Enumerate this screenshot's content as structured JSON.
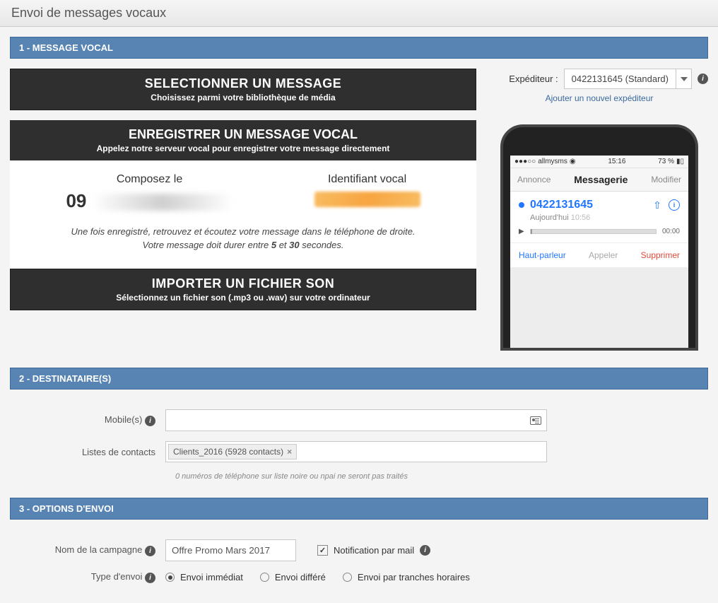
{
  "page": {
    "title": "Envoi de messages vocaux"
  },
  "section1": {
    "header": "1 - MESSAGE VOCAL",
    "select_msg": {
      "title": "SELECTIONNER UN MESSAGE",
      "sub": "Choisissez parmi votre bibliothèque de média"
    },
    "record": {
      "title": "ENREGISTRER UN MESSAGE VOCAL",
      "sub": "Appelez notre serveur vocal pour enregistrer votre message directement",
      "compose_label": "Composez le",
      "compose_prefix": "09",
      "ident_label": "Identifiant vocal",
      "note1": "Une fois enregistré, retrouvez et écoutez votre message dans le téléphone de droite.",
      "note2_a": "Votre message doit durer entre ",
      "note2_b": "5",
      "note2_c": " et ",
      "note2_d": "30",
      "note2_e": " secondes."
    },
    "import": {
      "title": "IMPORTER UN FICHIER SON",
      "sub": "Sélectionnez un fichier son (.mp3 ou .wav) sur votre ordinateur"
    },
    "sender": {
      "label": "Expéditeur :",
      "value": "0422131645 (Standard)",
      "add_link": "Ajouter un nouvel expéditeur"
    },
    "phone": {
      "carrier": "allmysms",
      "time": "15:16",
      "battery": "73 %",
      "nav_left": "Annonce",
      "nav_center": "Messagerie",
      "nav_right": "Modifier",
      "vm_number": "0422131645",
      "vm_date_a": "Aujourd'hui",
      "vm_date_b": "10:56",
      "vm_duration": "00:00",
      "action_speaker": "Haut-parleur",
      "action_call": "Appeler",
      "action_delete": "Supprimer"
    }
  },
  "section2": {
    "header": "2 - DESTINATAIRE(S)",
    "mobiles_label": "Mobile(s)",
    "lists_label": "Listes de contacts",
    "list_tag": "Clients_2016 (5928 contacts)",
    "hint": "0 numéros de téléphone sur liste noire ou npai ne seront pas traités"
  },
  "section3": {
    "header": "3 - OPTIONS D'ENVOI",
    "campaign_label": "Nom de la campagne",
    "campaign_value": "Offre Promo Mars 2017",
    "notif_label": "Notification par mail",
    "type_label": "Type d'envoi",
    "radio_immediate": "Envoi immédiat",
    "radio_deferred": "Envoi différé",
    "radio_slots": "Envoi par tranches horaires"
  }
}
